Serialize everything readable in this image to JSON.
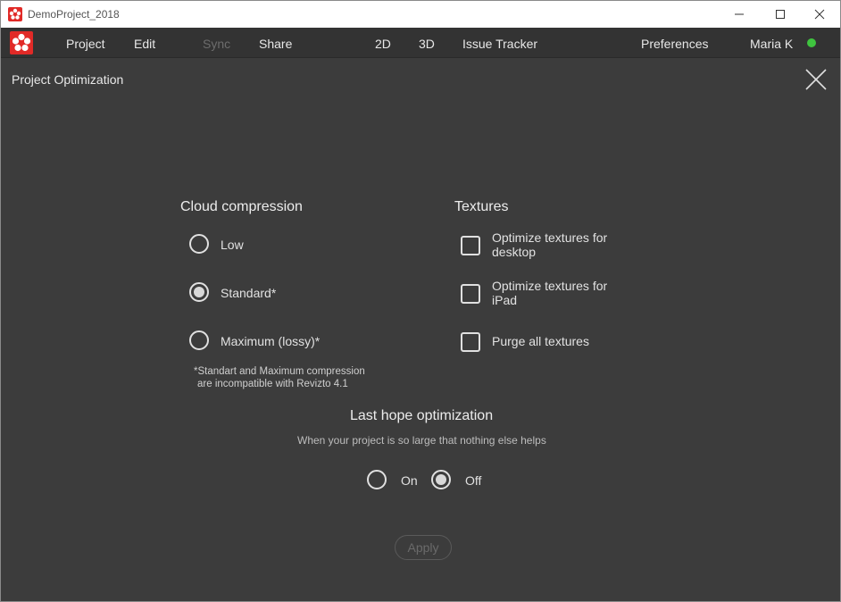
{
  "window": {
    "title": "DemoProject_2018"
  },
  "menu": {
    "project": "Project",
    "edit": "Edit",
    "sync": "Sync",
    "share": "Share",
    "view_2d": "2D",
    "view_3d": "3D",
    "issue_tracker": "Issue Tracker",
    "preferences": "Preferences",
    "user": "Maria K",
    "user_status_color": "#3fc43f"
  },
  "panel": {
    "title": "Project Optimization"
  },
  "cloud_compression": {
    "heading": "Cloud compression",
    "options": [
      {
        "label": "Low",
        "selected": false
      },
      {
        "label": "Standard*",
        "selected": true
      },
      {
        "label": "Maximum (lossy)*",
        "selected": false
      }
    ],
    "note_line1": "*Standart and Maximum compression",
    "note_line2": "are incompatible with Revizto 4.1"
  },
  "textures": {
    "heading": "Textures",
    "options": [
      {
        "label_line1": "Optimize textures for",
        "label_line2": "desktop",
        "checked": false
      },
      {
        "label_line1": "Optimize textures for",
        "label_line2": "iPad",
        "checked": false
      },
      {
        "label_line1": "Purge all textures",
        "checked": false
      }
    ]
  },
  "last_hope": {
    "heading": "Last hope optimization",
    "subtitle": "When your project is so large that nothing else helps",
    "on_label": "On",
    "off_label": "Off",
    "selected": "Off"
  },
  "apply_label": "Apply",
  "colors": {
    "brand": "#e12a27",
    "background": "#3c3c3c",
    "menubar": "#333333"
  }
}
